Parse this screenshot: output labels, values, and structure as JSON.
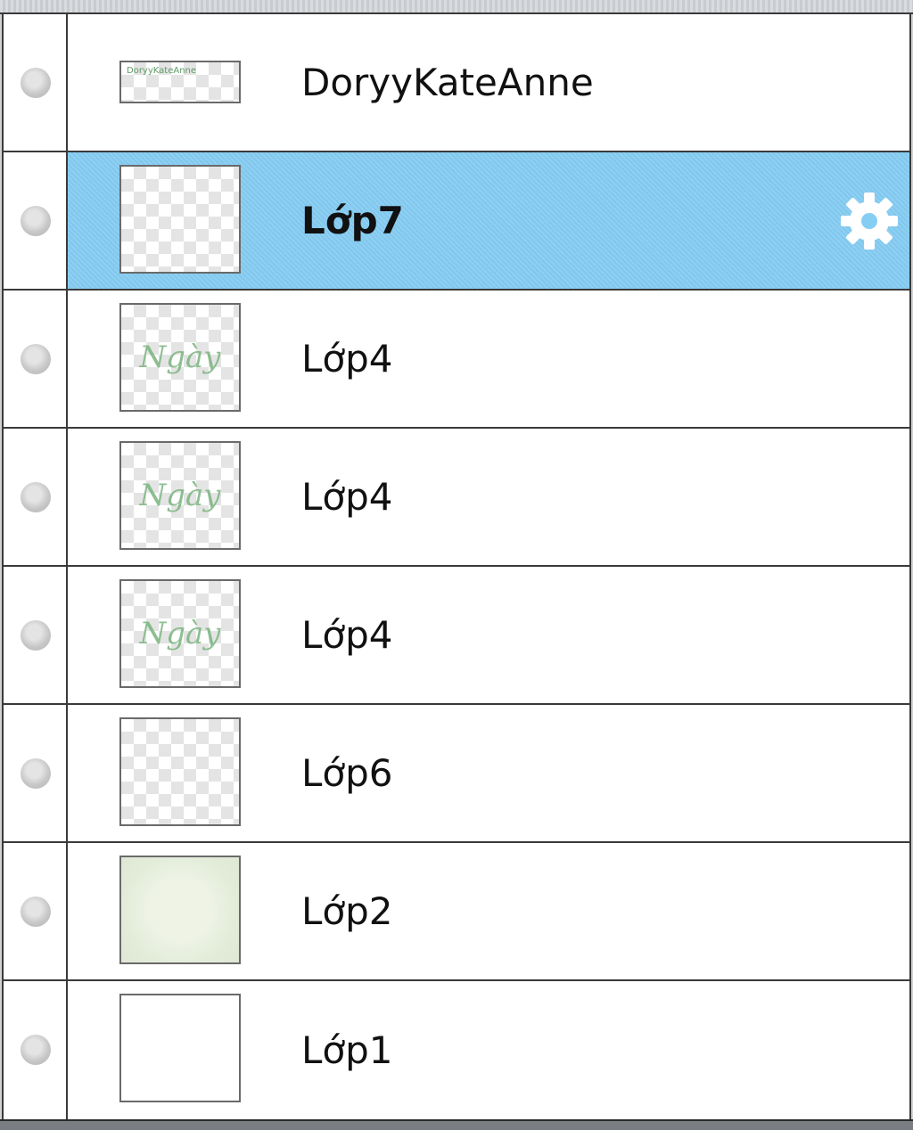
{
  "layers_panel": {
    "layers": [
      {
        "name": "DoryyKateAnne",
        "thumbnail": "watermark-text",
        "thumb_text": "DoryyKateAnne",
        "selected": false,
        "visibility_icon": "circle-dot-icon"
      },
      {
        "name": "Lớp7",
        "thumbnail": "transparent",
        "thumb_text": "",
        "selected": true,
        "visibility_icon": "circle-dot-icon",
        "settings_icon": "gear-icon"
      },
      {
        "name": "Lớp4",
        "thumbnail": "script-text",
        "thumb_text": "Ngày",
        "selected": false,
        "visibility_icon": "circle-dot-icon"
      },
      {
        "name": "Lớp4",
        "thumbnail": "script-text",
        "thumb_text": "Ngày",
        "selected": false,
        "visibility_icon": "circle-dot-icon"
      },
      {
        "name": "Lớp4",
        "thumbnail": "script-text",
        "thumb_text": "Ngày",
        "selected": false,
        "visibility_icon": "circle-dot-icon"
      },
      {
        "name": "Lớp6",
        "thumbnail": "transparent",
        "thumb_text": "",
        "selected": false,
        "visibility_icon": "circle-dot-icon"
      },
      {
        "name": "Lớp2",
        "thumbnail": "texture",
        "thumb_text": "",
        "selected": false,
        "visibility_icon": "circle-dot-icon"
      },
      {
        "name": "Lớp1",
        "thumbnail": "white",
        "thumb_text": "",
        "selected": false,
        "visibility_icon": "circle-dot-icon"
      }
    ]
  },
  "colors": {
    "selected_row": "#86cdf3",
    "row_background": "#ffffff",
    "divider": "#3a3a3a",
    "thumbnail_script": "#7ab57e"
  }
}
